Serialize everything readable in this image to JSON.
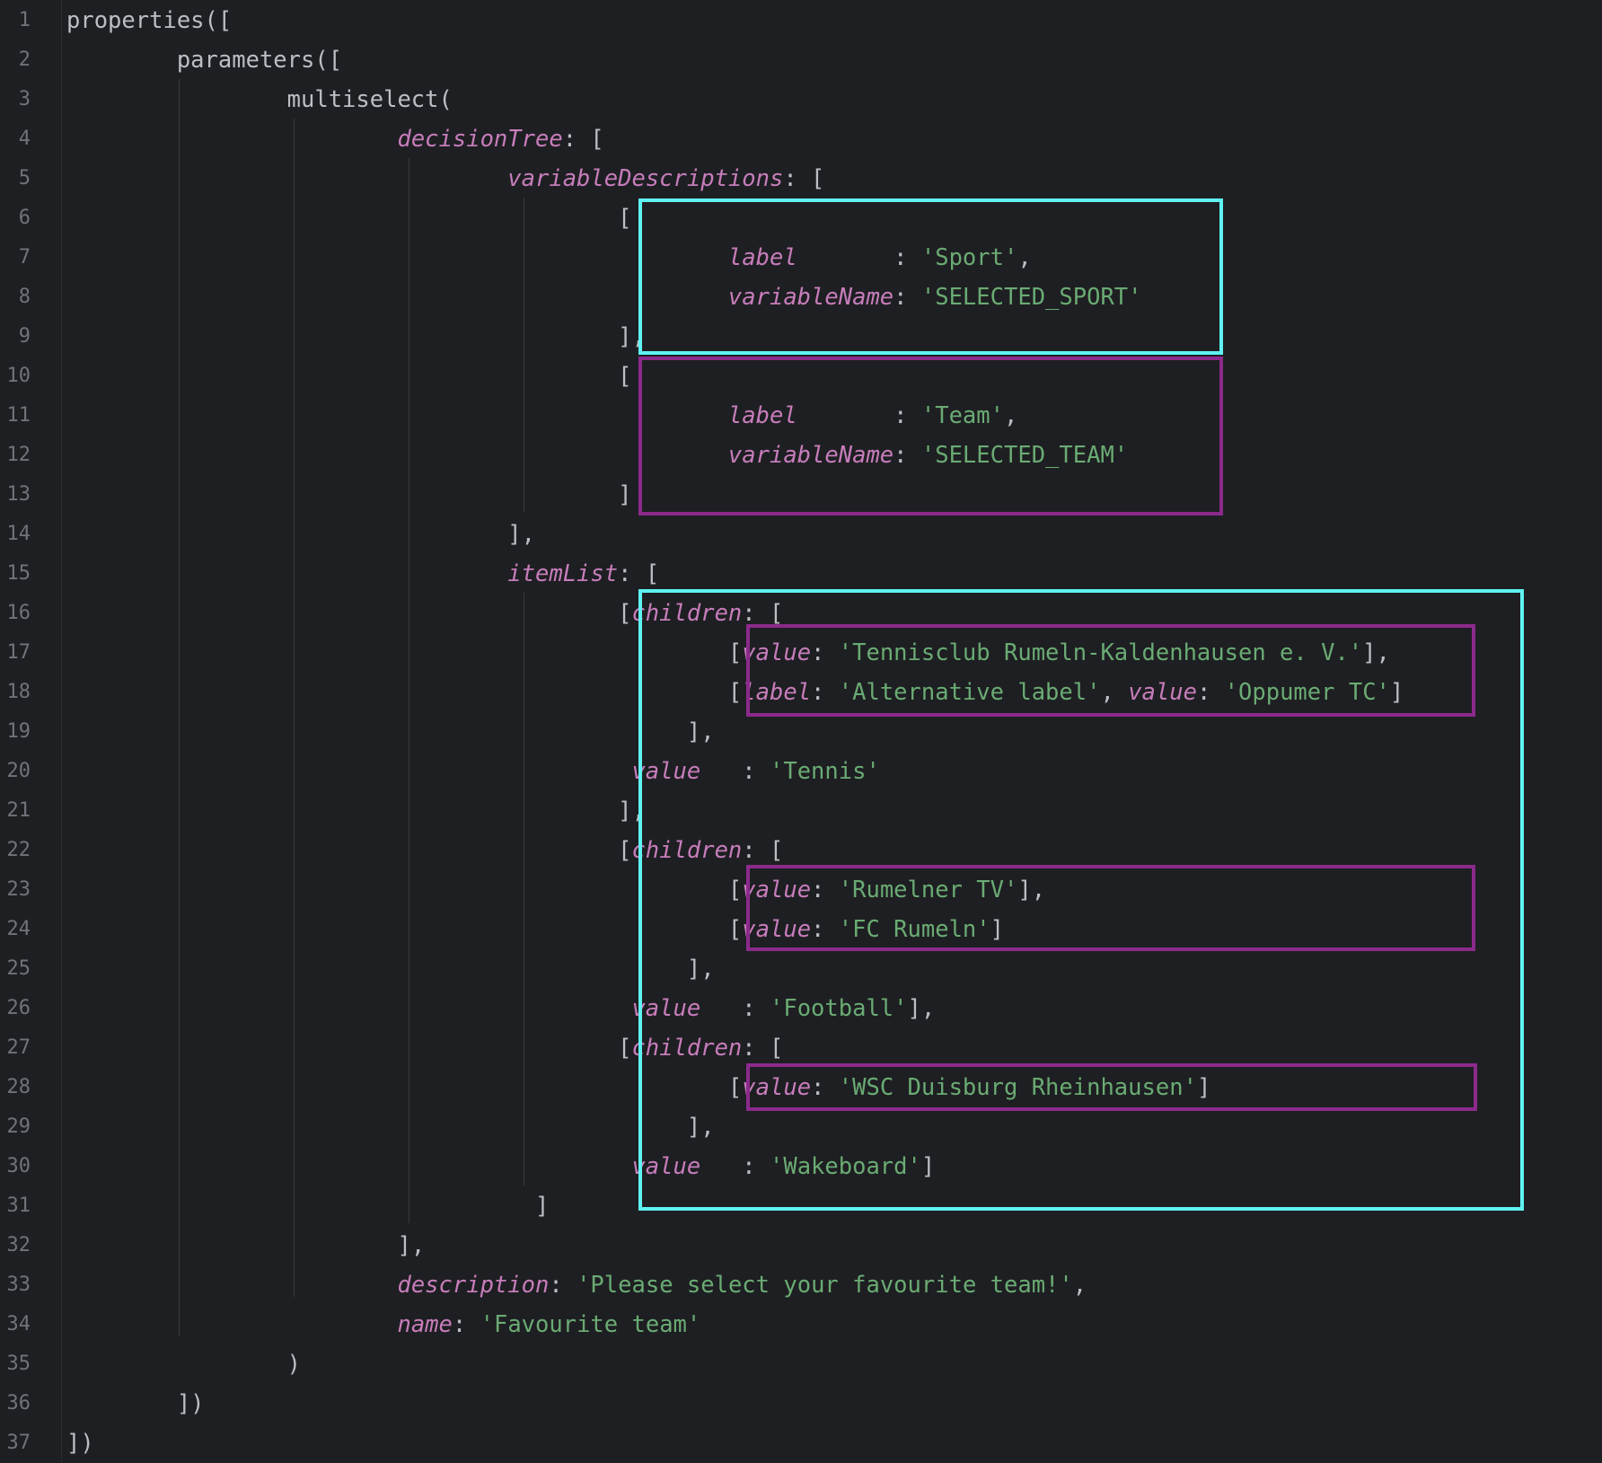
{
  "colors": {
    "background": "#1e1f22",
    "default_text": "#bcbec4",
    "line_number": "#6f737a",
    "key": "#c77dbb",
    "string": "#6aab73",
    "highlight_cyan": "#5ff2f2",
    "highlight_purple": "#8c2a8c"
  },
  "line_numbers": [
    "1",
    "2",
    "3",
    "4",
    "5",
    "6",
    "7",
    "8",
    "9",
    "10",
    "11",
    "12",
    "13",
    "14",
    "15",
    "16",
    "17",
    "18",
    "19",
    "20",
    "21",
    "22",
    "23",
    "24",
    "25",
    "26",
    "27",
    "28",
    "29",
    "30",
    "31",
    "32",
    "33",
    "34",
    "35",
    "36",
    "37"
  ],
  "code_lines": [
    {
      "ln": 1,
      "indent": "",
      "tokens": [
        {
          "t": "properties([",
          "c": "plain"
        }
      ]
    },
    {
      "ln": 2,
      "indent": "        ",
      "tokens": [
        {
          "t": "parameters([",
          "c": "plain"
        }
      ]
    },
    {
      "ln": 3,
      "indent": "                ",
      "tokens": [
        {
          "t": "multiselect(",
          "c": "plain"
        }
      ]
    },
    {
      "ln": 4,
      "indent": "                        ",
      "tokens": [
        {
          "t": "decisionTree",
          "c": "kw"
        },
        {
          "t": ": [",
          "c": "plain"
        }
      ]
    },
    {
      "ln": 5,
      "indent": "                                ",
      "tokens": [
        {
          "t": "variableDescriptions",
          "c": "kw"
        },
        {
          "t": ": [",
          "c": "plain"
        }
      ]
    },
    {
      "ln": 6,
      "indent": "                                        ",
      "tokens": [
        {
          "t": "[",
          "c": "plain"
        }
      ]
    },
    {
      "ln": 7,
      "indent": "                                                ",
      "tokens": [
        {
          "t": "label",
          "c": "kw"
        },
        {
          "t": "       : ",
          "c": "plain"
        },
        {
          "t": "'Sport'",
          "c": "str"
        },
        {
          "t": ",",
          "c": "plain"
        }
      ]
    },
    {
      "ln": 8,
      "indent": "                                                ",
      "tokens": [
        {
          "t": "variableName",
          "c": "kw"
        },
        {
          "t": ": ",
          "c": "plain"
        },
        {
          "t": "'SELECTED_SPORT'",
          "c": "str"
        }
      ]
    },
    {
      "ln": 9,
      "indent": "                                        ",
      "tokens": [
        {
          "t": "],",
          "c": "plain"
        }
      ]
    },
    {
      "ln": 10,
      "indent": "                                        ",
      "tokens": [
        {
          "t": "[",
          "c": "plain"
        }
      ]
    },
    {
      "ln": 11,
      "indent": "                                                ",
      "tokens": [
        {
          "t": "label",
          "c": "kw"
        },
        {
          "t": "       : ",
          "c": "plain"
        },
        {
          "t": "'Team'",
          "c": "str"
        },
        {
          "t": ",",
          "c": "plain"
        }
      ]
    },
    {
      "ln": 12,
      "indent": "                                                ",
      "tokens": [
        {
          "t": "variableName",
          "c": "kw"
        },
        {
          "t": ": ",
          "c": "plain"
        },
        {
          "t": "'SELECTED_TEAM'",
          "c": "str"
        }
      ]
    },
    {
      "ln": 13,
      "indent": "                                        ",
      "tokens": [
        {
          "t": "]",
          "c": "plain"
        }
      ]
    },
    {
      "ln": 14,
      "indent": "                                ",
      "tokens": [
        {
          "t": "],",
          "c": "plain"
        }
      ]
    },
    {
      "ln": 15,
      "indent": "                                ",
      "tokens": [
        {
          "t": "itemList",
          "c": "kw"
        },
        {
          "t": ": [",
          "c": "plain"
        }
      ]
    },
    {
      "ln": 16,
      "indent": "                                        ",
      "tokens": [
        {
          "t": "[",
          "c": "plain"
        },
        {
          "t": "children",
          "c": "kw"
        },
        {
          "t": ": [",
          "c": "plain"
        }
      ]
    },
    {
      "ln": 17,
      "indent": "                                                ",
      "tokens": [
        {
          "t": "[",
          "c": "plain"
        },
        {
          "t": "value",
          "c": "kw"
        },
        {
          "t": ": ",
          "c": "plain"
        },
        {
          "t": "'Tennisclub Rumeln-Kaldenhausen e. V.'",
          "c": "str"
        },
        {
          "t": "],",
          "c": "plain"
        }
      ]
    },
    {
      "ln": 18,
      "indent": "                                                ",
      "tokens": [
        {
          "t": "[",
          "c": "plain"
        },
        {
          "t": "label",
          "c": "kw"
        },
        {
          "t": ": ",
          "c": "plain"
        },
        {
          "t": "'Alternative label'",
          "c": "str"
        },
        {
          "t": ", ",
          "c": "plain"
        },
        {
          "t": "value",
          "c": "kw"
        },
        {
          "t": ": ",
          "c": "plain"
        },
        {
          "t": "'Oppumer TC'",
          "c": "str"
        },
        {
          "t": "]",
          "c": "plain"
        }
      ]
    },
    {
      "ln": 19,
      "indent": "                                             ",
      "tokens": [
        {
          "t": "],",
          "c": "plain"
        }
      ]
    },
    {
      "ln": 20,
      "indent": "                                         ",
      "tokens": [
        {
          "t": "value",
          "c": "kw"
        },
        {
          "t": "   : ",
          "c": "plain"
        },
        {
          "t": "'Tennis'",
          "c": "str"
        }
      ]
    },
    {
      "ln": 21,
      "indent": "                                        ",
      "tokens": [
        {
          "t": "],",
          "c": "plain"
        }
      ]
    },
    {
      "ln": 22,
      "indent": "                                        ",
      "tokens": [
        {
          "t": "[",
          "c": "plain"
        },
        {
          "t": "children",
          "c": "kw"
        },
        {
          "t": ": [",
          "c": "plain"
        }
      ]
    },
    {
      "ln": 23,
      "indent": "                                                ",
      "tokens": [
        {
          "t": "[",
          "c": "plain"
        },
        {
          "t": "value",
          "c": "kw"
        },
        {
          "t": ": ",
          "c": "plain"
        },
        {
          "t": "'Rumelner TV'",
          "c": "str"
        },
        {
          "t": "],",
          "c": "plain"
        }
      ]
    },
    {
      "ln": 24,
      "indent": "                                                ",
      "tokens": [
        {
          "t": "[",
          "c": "plain"
        },
        {
          "t": "value",
          "c": "kw"
        },
        {
          "t": ": ",
          "c": "plain"
        },
        {
          "t": "'FC Rumeln'",
          "c": "str"
        },
        {
          "t": "]",
          "c": "plain"
        }
      ]
    },
    {
      "ln": 25,
      "indent": "                                             ",
      "tokens": [
        {
          "t": "],",
          "c": "plain"
        }
      ]
    },
    {
      "ln": 26,
      "indent": "                                         ",
      "tokens": [
        {
          "t": "value",
          "c": "kw"
        },
        {
          "t": "   : ",
          "c": "plain"
        },
        {
          "t": "'Football'",
          "c": "str"
        },
        {
          "t": "],",
          "c": "plain"
        }
      ]
    },
    {
      "ln": 27,
      "indent": "                                        ",
      "tokens": [
        {
          "t": "[",
          "c": "plain"
        },
        {
          "t": "children",
          "c": "kw"
        },
        {
          "t": ": [",
          "c": "plain"
        }
      ]
    },
    {
      "ln": 28,
      "indent": "                                                ",
      "tokens": [
        {
          "t": "[",
          "c": "plain"
        },
        {
          "t": "value",
          "c": "kw"
        },
        {
          "t": ": ",
          "c": "plain"
        },
        {
          "t": "'WSC Duisburg Rheinhausen'",
          "c": "str"
        },
        {
          "t": "]",
          "c": "plain"
        }
      ]
    },
    {
      "ln": 29,
      "indent": "                                             ",
      "tokens": [
        {
          "t": "],",
          "c": "plain"
        }
      ]
    },
    {
      "ln": 30,
      "indent": "                                         ",
      "tokens": [
        {
          "t": "value",
          "c": "kw"
        },
        {
          "t": "   : ",
          "c": "plain"
        },
        {
          "t": "'Wakeboard'",
          "c": "str"
        },
        {
          "t": "]",
          "c": "plain"
        }
      ]
    },
    {
      "ln": 31,
      "indent": "                                  ",
      "tokens": [
        {
          "t": "]",
          "c": "plain"
        }
      ]
    },
    {
      "ln": 32,
      "indent": "                        ",
      "tokens": [
        {
          "t": "],",
          "c": "plain"
        }
      ]
    },
    {
      "ln": 33,
      "indent": "                        ",
      "tokens": [
        {
          "t": "description",
          "c": "kw"
        },
        {
          "t": ": ",
          "c": "plain"
        },
        {
          "t": "'Please select your favourite team!'",
          "c": "str"
        },
        {
          "t": ",",
          "c": "plain"
        }
      ]
    },
    {
      "ln": 34,
      "indent": "                        ",
      "tokens": [
        {
          "t": "name",
          "c": "kw"
        },
        {
          "t": ": ",
          "c": "plain"
        },
        {
          "t": "'Favourite team'",
          "c": "str"
        }
      ]
    },
    {
      "ln": 35,
      "indent": "                ",
      "tokens": [
        {
          "t": ")",
          "c": "plain"
        }
      ]
    },
    {
      "ln": 36,
      "indent": "        ",
      "tokens": [
        {
          "t": "])",
          "c": "plain"
        }
      ]
    },
    {
      "ln": 37,
      "indent": "",
      "tokens": [
        {
          "t": "])",
          "c": "plain"
        }
      ]
    }
  ]
}
